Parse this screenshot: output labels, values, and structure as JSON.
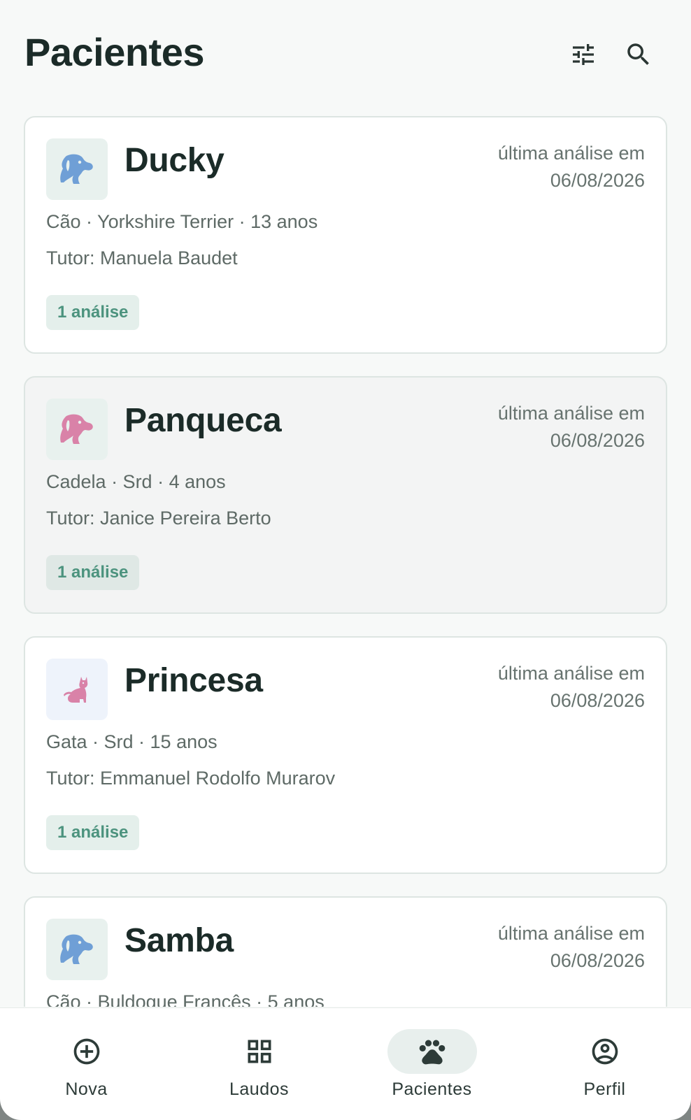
{
  "header": {
    "title": "Pacientes",
    "icons": [
      "tune-icon",
      "search-icon"
    ]
  },
  "patients": [
    {
      "name": "Ducky",
      "species_icon": "dog-icon",
      "icon_color": "#6f9fd6",
      "last_label": "última análise em",
      "last_date": "06/08/2026",
      "details": "Cão · Yorkshire Terrier · 13 anos",
      "tutor": "Tutor: Manuela Baudet",
      "badge": "1 análise"
    },
    {
      "name": "Panqueca",
      "species_icon": "dog-icon",
      "icon_color": "#d982a8",
      "last_label": "última análise em",
      "last_date": "06/08/2026",
      "details": "Cadela · Srd · 4 anos",
      "tutor": "Tutor: Janice Pereira Berto",
      "badge": "1 análise"
    },
    {
      "name": "Princesa",
      "species_icon": "cat-icon",
      "icon_color": "#d982a8",
      "last_label": "última análise em",
      "last_date": "06/08/2026",
      "details": "Gata · Srd · 15 anos",
      "tutor": "Tutor: Emmanuel Rodolfo Murarov",
      "badge": "1 análise"
    },
    {
      "name": "Samba",
      "species_icon": "dog-icon",
      "icon_color": "#6f9fd6",
      "last_label": "última análise em",
      "last_date": "06/08/2026",
      "details": "Cão · Buldogue Francês · 5 anos",
      "tutor": "",
      "badge": ""
    }
  ],
  "bottom_nav": {
    "items": [
      {
        "label": "Nova",
        "icon": "add-circle-icon"
      },
      {
        "label": "Laudos",
        "icon": "grid-icon"
      },
      {
        "label": "Pacientes",
        "icon": "paw-icon",
        "active": true
      },
      {
        "label": "Perfil",
        "icon": "account-circle-icon"
      }
    ]
  },
  "colors": {
    "text_dark": "#1b2b28",
    "text_muted": "#5e6a66",
    "badge_text": "#4c937e",
    "badge_bg": "#e4efeb",
    "accent_blue": "#6f9fd6",
    "accent_pink": "#d982a8"
  }
}
